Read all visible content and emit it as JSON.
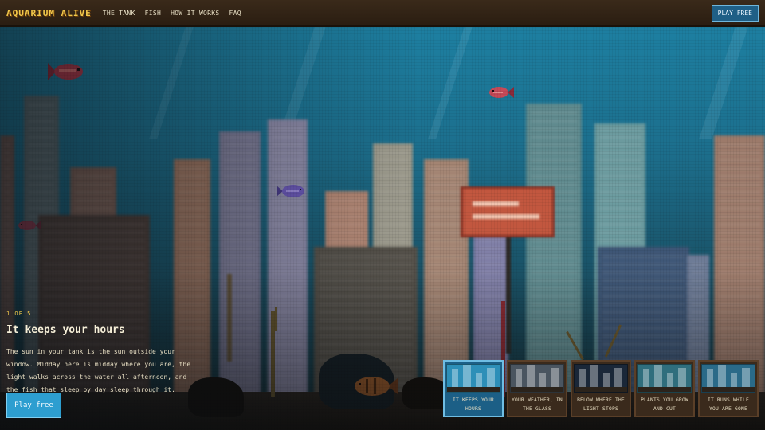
{
  "brand": {
    "name": "AQUARIUM ALIVE"
  },
  "nav": {
    "items": [
      "THE TANK",
      "FISH",
      "HOW IT WORKS",
      "FAQ"
    ]
  },
  "header": {
    "cta_label": "PLAY FREE"
  },
  "slide": {
    "counter": "1 OF 5",
    "title": "It keeps your hours",
    "description": "The sun in your tank is the sun outside your window. Midday here is midday where you are, the light walks across the water all afternoon, and the fish that sleep by day sleep through it.",
    "cta_label": "Play free"
  },
  "thumbnails": [
    {
      "caption": "IT KEEPS YOUR HOURS",
      "active": true,
      "tint": "#2d8fb8"
    },
    {
      "caption": "YOUR WEATHER, IN THE GLASS",
      "active": false,
      "tint": "#4a5560"
    },
    {
      "caption": "BELOW WHERE THE LIGHT STOPS",
      "active": false,
      "tint": "#1a2738"
    },
    {
      "caption": "PLANTS YOU GROW AND CUT",
      "active": false,
      "tint": "#2f6e7d"
    },
    {
      "caption": "IT RUNS WHILE YOU ARE GONE",
      "active": false,
      "tint": "#2a6a88"
    }
  ],
  "colors": {
    "accent": "#2d9ed0",
    "brand": "#f2c84b",
    "header_bg": "#2a1d11"
  },
  "icons": [
    "fish-icon"
  ]
}
